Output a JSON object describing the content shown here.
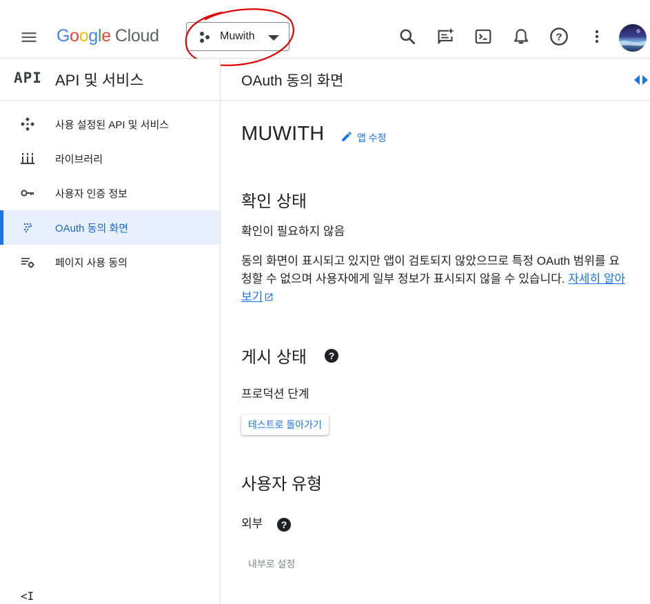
{
  "topbar": {
    "logo": {
      "google": [
        {
          "ch": "G",
          "color": "#4285F4"
        },
        {
          "ch": "o",
          "color": "#EA4335"
        },
        {
          "ch": "o",
          "color": "#FBBC05"
        },
        {
          "ch": "g",
          "color": "#4285F4"
        },
        {
          "ch": "l",
          "color": "#34A853"
        },
        {
          "ch": "e",
          "color": "#EA4335"
        }
      ],
      "cloud": "Cloud"
    },
    "project": "Muwith",
    "annotation_color": "#e00000"
  },
  "sidebar": {
    "glyph": "API",
    "title": "API 및 서비스",
    "items": [
      {
        "label": "사용 설정된 API 및 서비스",
        "icon": "enabled-apis-icon"
      },
      {
        "label": "라이브러리",
        "icon": "library-icon"
      },
      {
        "label": "사용자 인증 정보",
        "icon": "key-icon"
      },
      {
        "label": "OAuth 동의 화면",
        "icon": "oauth-dots-icon",
        "active": true
      },
      {
        "label": "페이지 사용 동의",
        "icon": "page-usage-settings-icon"
      }
    ],
    "collapse": "<I"
  },
  "main": {
    "title": "OAuth 동의 화면",
    "app_name": "MUWITH",
    "edit_label": "앱 수정",
    "verification": {
      "title": "확인 상태",
      "status": "확인이 필요하지 않음",
      "desc": "동의 화면이 표시되고 있지만 앱이 검토되지 않았으므로 특정 OAuth 범위를 요청할 수 없으며 사용자에게 일부 정보가 표시되지 않을 수 있습니다.",
      "link": "자세히 알아보기"
    },
    "publishing": {
      "title": "게시 상태",
      "status": "프로덕션 단계",
      "button": "테스트로 돌아가기"
    },
    "user_type": {
      "title": "사용자 유형",
      "value": "외부",
      "button": "내부로 설정"
    }
  },
  "colors": {
    "accent": "#1a73e8",
    "active_bg": "#e8f0fe",
    "divider": "#dadce0"
  }
}
